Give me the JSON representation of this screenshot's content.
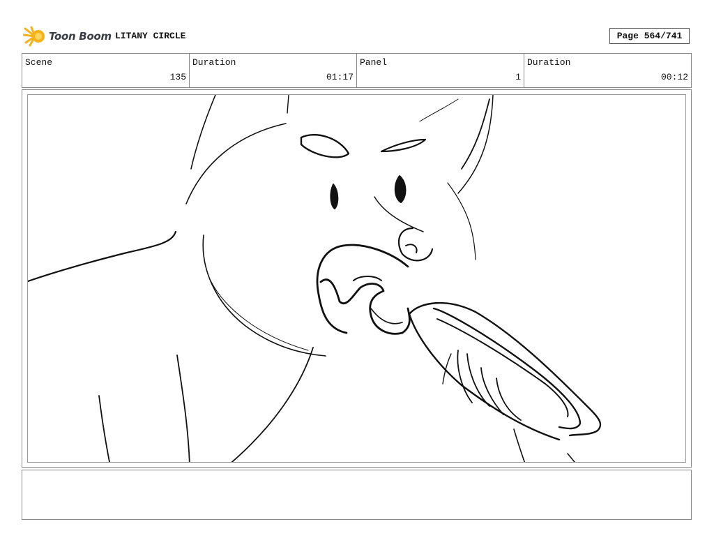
{
  "header": {
    "brand": "Toon Boom",
    "project_title": "LITANY CIRCLE",
    "page_label": "Page 564/741"
  },
  "info": {
    "scene_label": "Scene",
    "scene_value": "135",
    "scene_duration_label": "Duration",
    "scene_duration_value": "01:17",
    "panel_label": "Panel",
    "panel_value": "1",
    "panel_duration_label": "Duration",
    "panel_duration_value": "00:12"
  },
  "notes": {
    "text": ""
  }
}
